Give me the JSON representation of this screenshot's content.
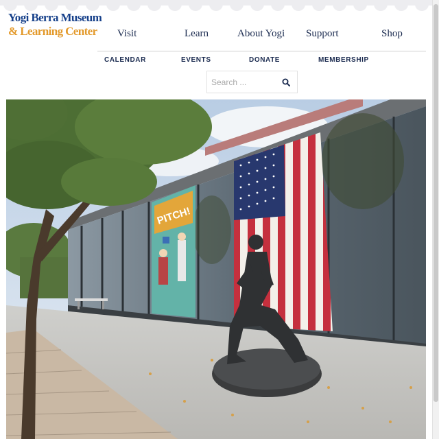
{
  "logo": {
    "line1": "Yogi Berra Museum",
    "line2": "& Learning Center"
  },
  "main_nav": [
    {
      "label": "Visit"
    },
    {
      "label": "Learn"
    },
    {
      "label": "About Yogi"
    },
    {
      "label": "Support"
    },
    {
      "label": "Shop"
    }
  ],
  "sub_nav": [
    {
      "label": "CALENDAR"
    },
    {
      "label": "EVENTS"
    },
    {
      "label": "DONATE"
    },
    {
      "label": "MEMBERSHIP"
    }
  ],
  "search": {
    "placeholder": "Search ...",
    "icon": "search-icon"
  },
  "hero": {
    "banner_text": "PITCH!"
  },
  "colors": {
    "nav_text": "#1a2a4f",
    "logo_blue": "#16408a",
    "logo_gold": "#e39a2c"
  }
}
